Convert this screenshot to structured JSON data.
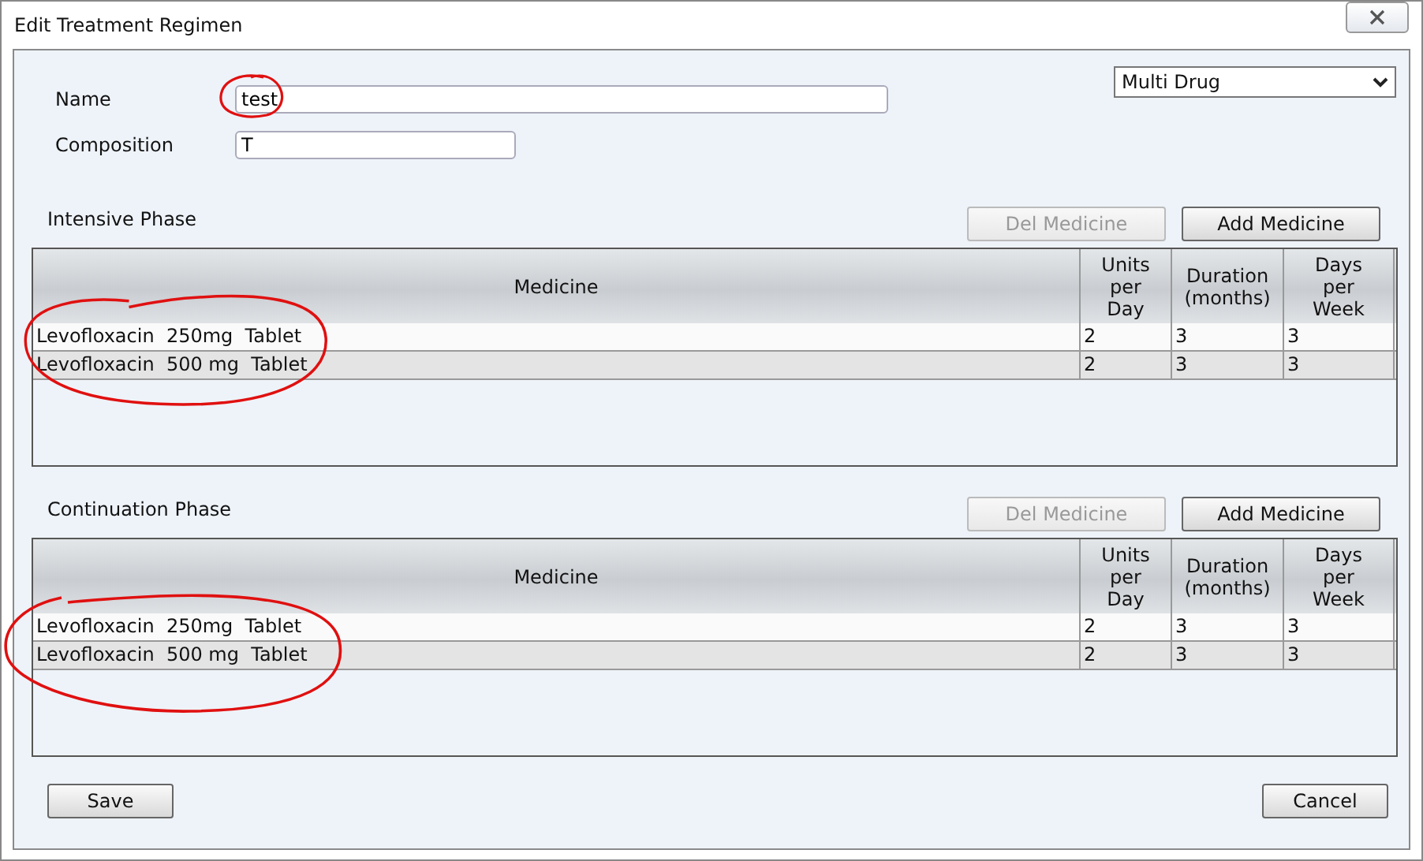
{
  "window": {
    "title": "Edit Treatment Regimen"
  },
  "form": {
    "name_label": "Name",
    "name_value": "test",
    "composition_label": "Composition",
    "composition_value": "T",
    "type_select": "Multi Drug"
  },
  "phases": [
    {
      "title": "Intensive Phase",
      "buttons": [
        {
          "label": "Del Medicine",
          "disabled": true
        },
        {
          "label": "Add Medicine",
          "disabled": false
        }
      ],
      "table": {
        "columns": [
          "Medicine",
          "Units per Day",
          "Duration (months)",
          "Days per Week"
        ],
        "rows": [
          [
            "Levofloxacin  250mg  Tablet",
            "2",
            "3",
            "3"
          ],
          [
            "Levofloxacin  500 mg  Tablet",
            "2",
            "3",
            "3"
          ]
        ]
      }
    },
    {
      "title": "Continuation Phase",
      "buttons": [
        {
          "label": "Del Medicine",
          "disabled": true
        },
        {
          "label": "Add Medicine",
          "disabled": false
        }
      ],
      "table": {
        "columns": [
          "Medicine",
          "Units per Day",
          "Duration (months)",
          "Days per Week"
        ],
        "rows": [
          [
            "Levofloxacin  250mg  Tablet",
            "2",
            "3",
            "3"
          ],
          [
            "Levofloxacin  500 mg  Tablet",
            "2",
            "3",
            "3"
          ]
        ]
      }
    }
  ],
  "footer": {
    "buttons": [
      "Save",
      "Cancel"
    ]
  }
}
